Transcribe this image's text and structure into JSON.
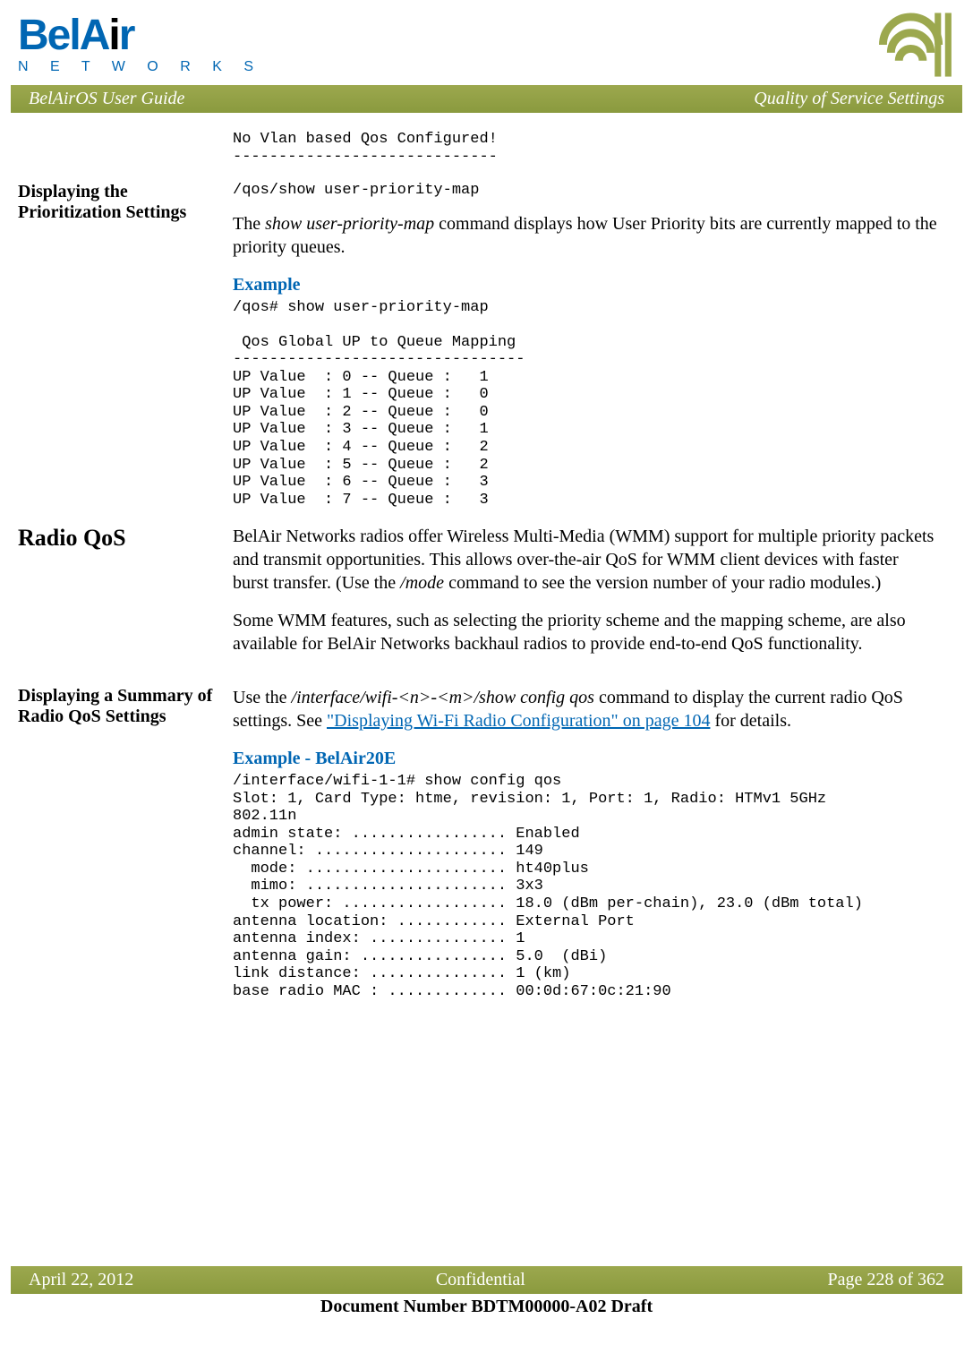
{
  "header": {
    "logo_main_bel": "Bel",
    "logo_main_a": "A",
    "logo_main_i": "i",
    "logo_main_r": "r",
    "logo_sub": "N E T W O R K S"
  },
  "titlebar": {
    "left": "BelAirOS User Guide",
    "right": "Quality of Service Settings"
  },
  "block_vlan_code": "No Vlan based Qos Configured!\n-----------------------------",
  "section_prioritization": {
    "heading": "Displaying the Prioritization Settings",
    "cmd": "/qos/show user-priority-map",
    "desc_pre": "The ",
    "desc_cmd": "show user-priority-map",
    "desc_post": " command displays how User Priority bits are currently mapped to the priority queues.",
    "example_label": "Example",
    "example_code": "/qos# show user-priority-map\n\n Qos Global UP to Queue Mapping\n--------------------------------\nUP Value  : 0 -- Queue :   1\nUP Value  : 1 -- Queue :   0\nUP Value  : 2 -- Queue :   0\nUP Value  : 3 -- Queue :   1\nUP Value  : 4 -- Queue :   2\nUP Value  : 5 -- Queue :   2\nUP Value  : 6 -- Queue :   3\nUP Value  : 7 -- Queue :   3"
  },
  "section_radioqos": {
    "heading": "Radio QoS",
    "p1_pre": "BelAir Networks radios offer Wireless Multi-Media (WMM) support for multiple priority packets and transmit opportunities. This allows over-the-air QoS for WMM client devices with faster burst transfer. (Use the ",
    "p1_cmd": "/mode",
    "p1_post": " command to see the version number of your radio modules.)",
    "p2": "Some WMM features, such as selecting the priority scheme and the mapping scheme, are also available for BelAir Networks backhaul radios to provide end-to-end QoS functionality."
  },
  "section_summary": {
    "heading": "Displaying a Summary of Radio QoS Settings",
    "p1_pre": "Use the ",
    "p1_cmd": "/interface/wifi-<n>-<m>/show config qos",
    "p1_mid": " command to display the current radio QoS settings. See ",
    "p1_link": "\"Displaying Wi-Fi Radio Configuration\" on page 104",
    "p1_post": " for details.",
    "example_label": "Example - BelAir20E",
    "example_code": "/interface/wifi-1-1# show config qos\nSlot: 1, Card Type: htme, revision: 1, Port: 1, Radio: HTMv1 5GHz \n802.11n\nadmin state: ................. Enabled\nchannel: ..................... 149\n  mode: ...................... ht40plus\n  mimo: ...................... 3x3\n  tx power: .................. 18.0 (dBm per-chain), 23.0 (dBm total)\nantenna location: ............ External Port\nantenna index: ............... 1\nantenna gain: ................ 5.0  (dBi)\nlink distance: ............... 1 (km)\nbase radio MAC : ............. 00:0d:67:0c:21:90"
  },
  "footer": {
    "date": "April 22, 2012",
    "conf": "Confidential",
    "page": "Page 228 of 362",
    "doc": "Document Number BDTM00000-A02 Draft"
  }
}
